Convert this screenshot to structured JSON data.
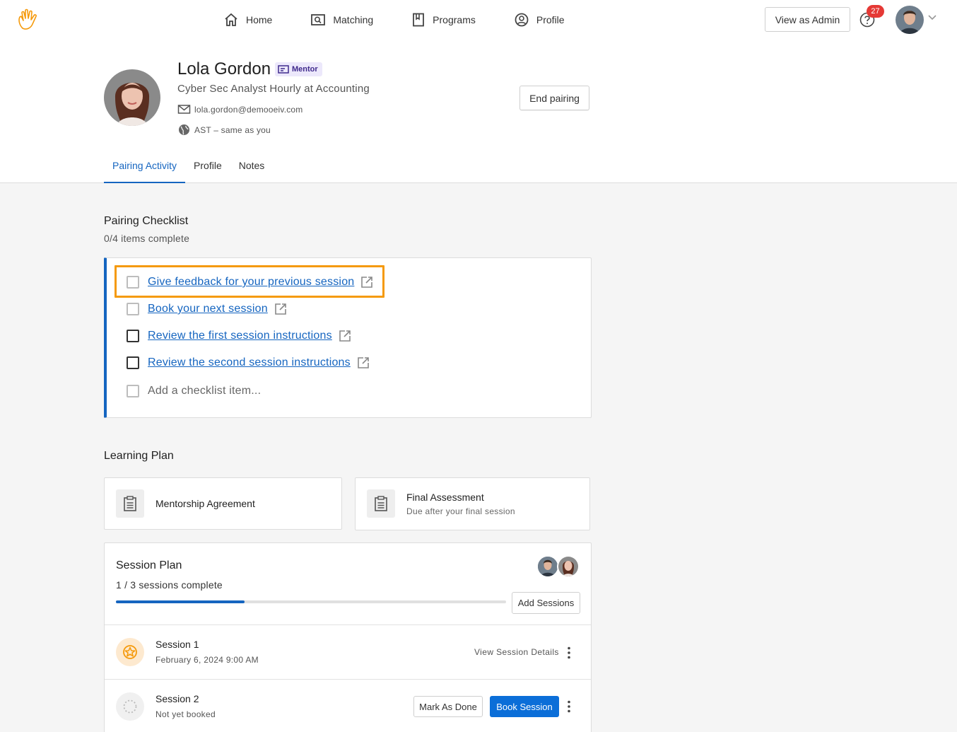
{
  "nav": {
    "items": [
      {
        "label": "Home",
        "icon": "home-icon"
      },
      {
        "label": "Matching",
        "icon": "matching-icon"
      },
      {
        "label": "Programs",
        "icon": "bookmark-icon"
      },
      {
        "label": "Profile",
        "icon": "user-circle-icon"
      }
    ],
    "admin_button": "View as Admin",
    "notification_count": "27"
  },
  "profile": {
    "name": "Lola Gordon",
    "role": "Mentor",
    "title": "Cyber Sec Analyst Hourly at Accounting",
    "email": "lola.gordon@demooeiv.com",
    "timezone": "AST – same as you",
    "end_button": "End pairing"
  },
  "tabs": [
    "Pairing Activity",
    "Profile",
    "Notes"
  ],
  "checklist": {
    "title": "Pairing Checklist",
    "progress": "0/4 items complete",
    "items": [
      "Give feedback for your previous session",
      "Book your next session",
      "Review the first session instructions",
      "Review the second session instructions"
    ],
    "add_placeholder": "Add a checklist item..."
  },
  "learning_plan": {
    "title": "Learning Plan",
    "cards": [
      {
        "title": "Mentorship Agreement",
        "subtitle": ""
      },
      {
        "title": "Final Assessment",
        "subtitle": "Due after your final session"
      }
    ]
  },
  "session_plan": {
    "title": "Session Plan",
    "progress_text": "1 / 3 sessions complete",
    "progress_fraction": 0.33,
    "add_button": "Add Sessions",
    "sessions": [
      {
        "name": "Session 1",
        "date": "February 6, 2024 9:00 AM",
        "action": "View Session Details"
      },
      {
        "name": "Session 2",
        "date": "Not yet booked",
        "mark_done": "Mark As Done",
        "book": "Book Session"
      }
    ]
  },
  "colors": {
    "accent": "#1565c0",
    "highlight": "#f59a0c",
    "badge": "#e53935",
    "primary_button": "#0b6ed8"
  }
}
